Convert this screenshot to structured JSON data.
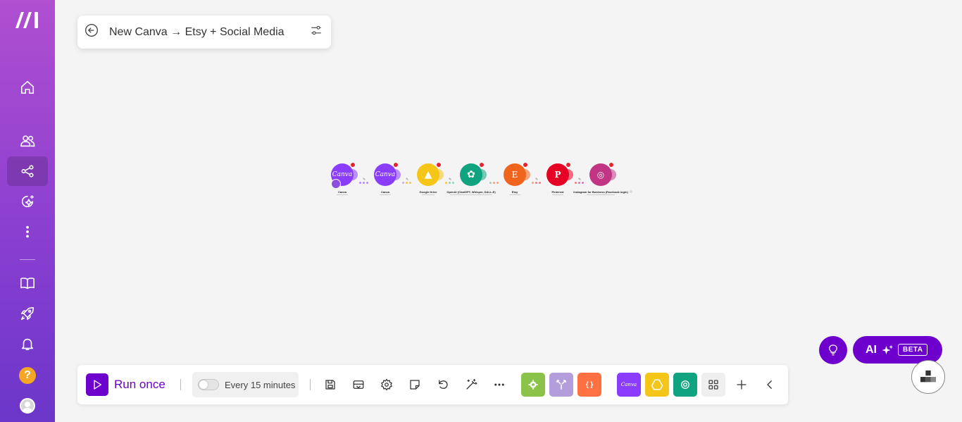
{
  "sidebar": {
    "items": [
      {
        "name": "home",
        "icon": "home-icon"
      },
      {
        "name": "organization",
        "icon": "users-icon"
      },
      {
        "name": "scenarios",
        "icon": "share-nodes-icon",
        "active": true
      },
      {
        "name": "ai-agents",
        "icon": "ai-sparkle-icon"
      },
      {
        "name": "more",
        "icon": "more-vertical-icon"
      },
      {
        "name": "documentation",
        "icon": "book-icon"
      },
      {
        "name": "whats-new",
        "icon": "rocket-icon"
      },
      {
        "name": "notifications",
        "icon": "bell-icon"
      },
      {
        "name": "help",
        "icon": "help-icon",
        "label": "?"
      },
      {
        "name": "profile",
        "icon": "avatar-icon"
      }
    ],
    "gradient": [
      "#b04fd0",
      "#6b36c9"
    ]
  },
  "header": {
    "title": "New Canva → Etsy + Social Media"
  },
  "flow": {
    "modules": [
      {
        "app": "Canva",
        "color": "#8b3dff",
        "glyph": "Canva"
      },
      {
        "app": "Canva",
        "color": "#8b3dff",
        "glyph": "Canva"
      },
      {
        "app": "Google Drive",
        "color": "#f5c518",
        "glyph": "▲"
      },
      {
        "app": "OpenAI (ChatGPT, Whisper, DALL-E)",
        "color": "#10a37f",
        "glyph": "✿"
      },
      {
        "app": "Etsy",
        "color": "#f1641e",
        "glyph": "E"
      },
      {
        "app": "Pinterest",
        "color": "#e60023",
        "glyph": "P"
      },
      {
        "app": "Instagram for Business (Facebook login)",
        "color": "#c13584",
        "glyph": "◎"
      }
    ]
  },
  "toolbar": {
    "run_label": "Run once",
    "schedule_label": "Every 15 minutes",
    "icons": [
      "save-icon",
      "explain-flow-icon",
      "settings-icon",
      "notes-icon",
      "undo-icon",
      "auto-align-icon",
      "more-horizontal-icon"
    ],
    "tools": [
      {
        "name": "tools",
        "color": "#8bc34a"
      },
      {
        "name": "flow-control",
        "color": "#b39ddb"
      },
      {
        "name": "json",
        "color": "#ff7043",
        "label": "{ }"
      }
    ],
    "apps": [
      {
        "name": "canva",
        "color": "#8b3dff",
        "label": "Canva"
      },
      {
        "name": "google-drive",
        "color": "#f5c518"
      },
      {
        "name": "openai",
        "color": "#10a37f"
      }
    ]
  },
  "floating": {
    "ai_label": "AI",
    "beta_label": "BETA",
    "accent": "#6d00cc"
  }
}
